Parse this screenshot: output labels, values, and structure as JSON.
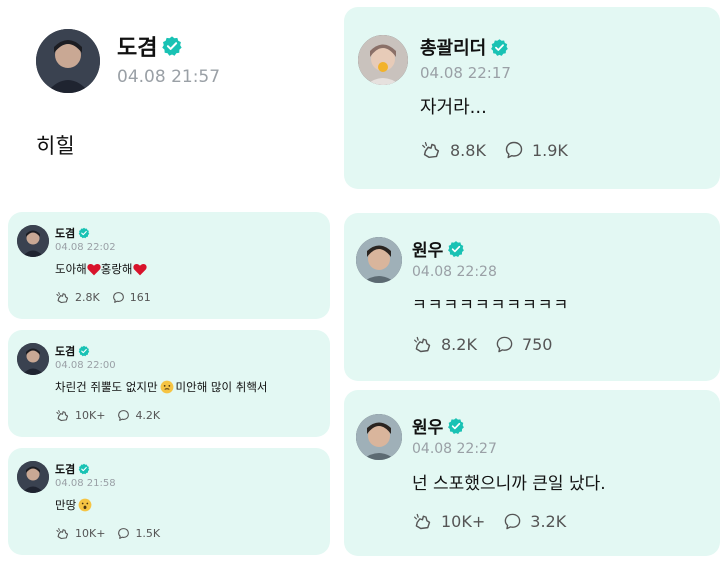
{
  "posts": [
    {
      "author": "도겸",
      "time": "04.08 21:57",
      "text": "히힐"
    },
    {
      "author": "총괄리더",
      "time": "04.08 22:17",
      "text": "자거라...",
      "reactions": "8.8K",
      "comments": "1.9K"
    },
    {
      "author": "도겸",
      "time": "04.08 22:02",
      "text_before": "도아해",
      "text_middle": "홍랑해",
      "reactions": "2.8K",
      "comments": "161"
    },
    {
      "author": "도겸",
      "time": "04.08 22:00",
      "text_before": "차린건 쥐뿔도 없지만",
      "text_after": "미안해 많이 취핵서",
      "reactions": "10K+",
      "comments": "4.2K"
    },
    {
      "author": "원우",
      "time": "04.08 22:28",
      "text": "ㅋㅋㅋㅋㅋㅋㅋㅋㅋㅋ",
      "reactions": "8.2K",
      "comments": "750"
    },
    {
      "author": "원우",
      "time": "04.08 22:27",
      "text": "넌 스포했으니까 큰일 났다.",
      "reactions": "10K+",
      "comments": "3.2K"
    },
    {
      "author": "도겸",
      "time": "04.08 21:58",
      "text_before": "만땅",
      "reactions": "10K+",
      "comments": "1.5K"
    }
  ],
  "icons": {
    "verified": "verified-badge-icon",
    "reaction": "reaction-hand-icon",
    "comment": "comment-bubble-icon",
    "heart": "heart-emoji",
    "emoji": "face-emoji"
  },
  "colors": {
    "card_background": "#e3f8f3",
    "verified": "#19c2b4",
    "heart": "#d8132b",
    "timestamp": "#9aa0a6"
  }
}
